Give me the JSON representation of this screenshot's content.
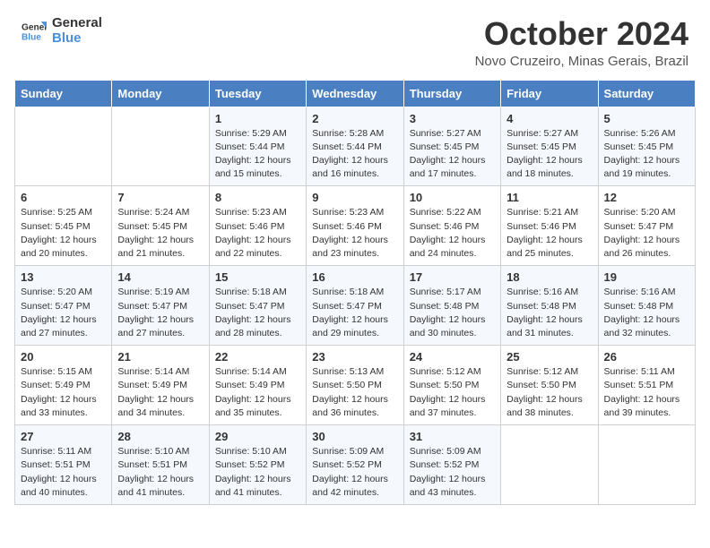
{
  "header": {
    "logo_line1": "General",
    "logo_line2": "Blue",
    "month": "October 2024",
    "location": "Novo Cruzeiro, Minas Gerais, Brazil"
  },
  "days_of_week": [
    "Sunday",
    "Monday",
    "Tuesday",
    "Wednesday",
    "Thursday",
    "Friday",
    "Saturday"
  ],
  "weeks": [
    [
      {
        "day": "",
        "info": ""
      },
      {
        "day": "",
        "info": ""
      },
      {
        "day": "1",
        "info": "Sunrise: 5:29 AM\nSunset: 5:44 PM\nDaylight: 12 hours and 15 minutes."
      },
      {
        "day": "2",
        "info": "Sunrise: 5:28 AM\nSunset: 5:44 PM\nDaylight: 12 hours and 16 minutes."
      },
      {
        "day": "3",
        "info": "Sunrise: 5:27 AM\nSunset: 5:45 PM\nDaylight: 12 hours and 17 minutes."
      },
      {
        "day": "4",
        "info": "Sunrise: 5:27 AM\nSunset: 5:45 PM\nDaylight: 12 hours and 18 minutes."
      },
      {
        "day": "5",
        "info": "Sunrise: 5:26 AM\nSunset: 5:45 PM\nDaylight: 12 hours and 19 minutes."
      }
    ],
    [
      {
        "day": "6",
        "info": "Sunrise: 5:25 AM\nSunset: 5:45 PM\nDaylight: 12 hours and 20 minutes."
      },
      {
        "day": "7",
        "info": "Sunrise: 5:24 AM\nSunset: 5:45 PM\nDaylight: 12 hours and 21 minutes."
      },
      {
        "day": "8",
        "info": "Sunrise: 5:23 AM\nSunset: 5:46 PM\nDaylight: 12 hours and 22 minutes."
      },
      {
        "day": "9",
        "info": "Sunrise: 5:23 AM\nSunset: 5:46 PM\nDaylight: 12 hours and 23 minutes."
      },
      {
        "day": "10",
        "info": "Sunrise: 5:22 AM\nSunset: 5:46 PM\nDaylight: 12 hours and 24 minutes."
      },
      {
        "day": "11",
        "info": "Sunrise: 5:21 AM\nSunset: 5:46 PM\nDaylight: 12 hours and 25 minutes."
      },
      {
        "day": "12",
        "info": "Sunrise: 5:20 AM\nSunset: 5:47 PM\nDaylight: 12 hours and 26 minutes."
      }
    ],
    [
      {
        "day": "13",
        "info": "Sunrise: 5:20 AM\nSunset: 5:47 PM\nDaylight: 12 hours and 27 minutes."
      },
      {
        "day": "14",
        "info": "Sunrise: 5:19 AM\nSunset: 5:47 PM\nDaylight: 12 hours and 27 minutes."
      },
      {
        "day": "15",
        "info": "Sunrise: 5:18 AM\nSunset: 5:47 PM\nDaylight: 12 hours and 28 minutes."
      },
      {
        "day": "16",
        "info": "Sunrise: 5:18 AM\nSunset: 5:47 PM\nDaylight: 12 hours and 29 minutes."
      },
      {
        "day": "17",
        "info": "Sunrise: 5:17 AM\nSunset: 5:48 PM\nDaylight: 12 hours and 30 minutes."
      },
      {
        "day": "18",
        "info": "Sunrise: 5:16 AM\nSunset: 5:48 PM\nDaylight: 12 hours and 31 minutes."
      },
      {
        "day": "19",
        "info": "Sunrise: 5:16 AM\nSunset: 5:48 PM\nDaylight: 12 hours and 32 minutes."
      }
    ],
    [
      {
        "day": "20",
        "info": "Sunrise: 5:15 AM\nSunset: 5:49 PM\nDaylight: 12 hours and 33 minutes."
      },
      {
        "day": "21",
        "info": "Sunrise: 5:14 AM\nSunset: 5:49 PM\nDaylight: 12 hours and 34 minutes."
      },
      {
        "day": "22",
        "info": "Sunrise: 5:14 AM\nSunset: 5:49 PM\nDaylight: 12 hours and 35 minutes."
      },
      {
        "day": "23",
        "info": "Sunrise: 5:13 AM\nSunset: 5:50 PM\nDaylight: 12 hours and 36 minutes."
      },
      {
        "day": "24",
        "info": "Sunrise: 5:12 AM\nSunset: 5:50 PM\nDaylight: 12 hours and 37 minutes."
      },
      {
        "day": "25",
        "info": "Sunrise: 5:12 AM\nSunset: 5:50 PM\nDaylight: 12 hours and 38 minutes."
      },
      {
        "day": "26",
        "info": "Sunrise: 5:11 AM\nSunset: 5:51 PM\nDaylight: 12 hours and 39 minutes."
      }
    ],
    [
      {
        "day": "27",
        "info": "Sunrise: 5:11 AM\nSunset: 5:51 PM\nDaylight: 12 hours and 40 minutes."
      },
      {
        "day": "28",
        "info": "Sunrise: 5:10 AM\nSunset: 5:51 PM\nDaylight: 12 hours and 41 minutes."
      },
      {
        "day": "29",
        "info": "Sunrise: 5:10 AM\nSunset: 5:52 PM\nDaylight: 12 hours and 41 minutes."
      },
      {
        "day": "30",
        "info": "Sunrise: 5:09 AM\nSunset: 5:52 PM\nDaylight: 12 hours and 42 minutes."
      },
      {
        "day": "31",
        "info": "Sunrise: 5:09 AM\nSunset: 5:52 PM\nDaylight: 12 hours and 43 minutes."
      },
      {
        "day": "",
        "info": ""
      },
      {
        "day": "",
        "info": ""
      }
    ]
  ]
}
